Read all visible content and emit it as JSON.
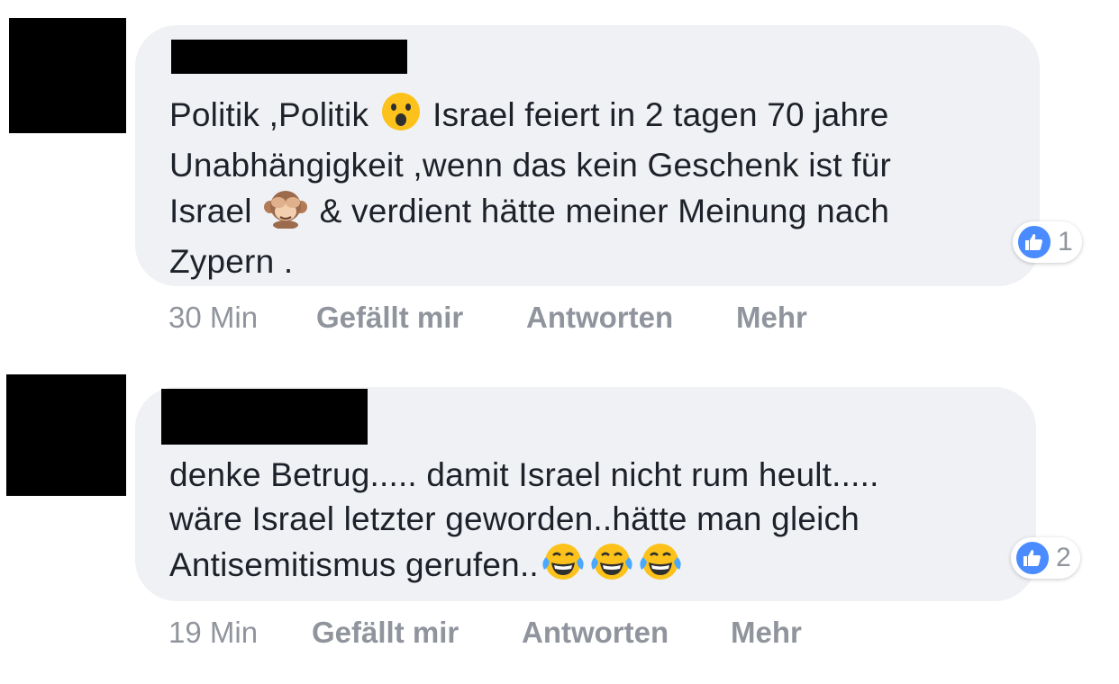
{
  "comments": [
    {
      "text_lines": [
        [
          "Politik ,Politik ",
          "{astonished}",
          " Israel feiert in 2 tagen 70 jahre"
        ],
        [
          "Unabhängigkeit ,wenn das kein Geschenk ist für"
        ],
        [
          "Israel ",
          "{monkey}",
          " & verdient hätte meiner Meinung nach"
        ],
        [
          "Zypern ."
        ]
      ],
      "reaction_count": "1",
      "time": "30 Min",
      "like_label": "Gefällt mir",
      "reply_label": "Antworten",
      "more_label": "Mehr"
    },
    {
      "text_lines": [
        [
          "denke Betrug..... damit Israel nicht rum heult....."
        ],
        [
          "wäre Israel letzter geworden..hätte man gleich"
        ],
        [
          "Antisemitismus gerufen..",
          "{laugh}",
          "{laugh}",
          "{laugh}"
        ]
      ],
      "reaction_count": "2",
      "time": "19 Min",
      "like_label": "Gefällt mir",
      "reply_label": "Antworten",
      "more_label": "Mehr"
    }
  ],
  "emoji_icons": {
    "astonished": "astonished-face-icon",
    "monkey": "see-no-evil-monkey-icon",
    "laugh": "tears-of-joy-icon"
  },
  "colors": {
    "bubble": "#f0f1f4",
    "text": "#1d2129",
    "meta": "#90949c",
    "like_blue": "#4a8cff"
  }
}
